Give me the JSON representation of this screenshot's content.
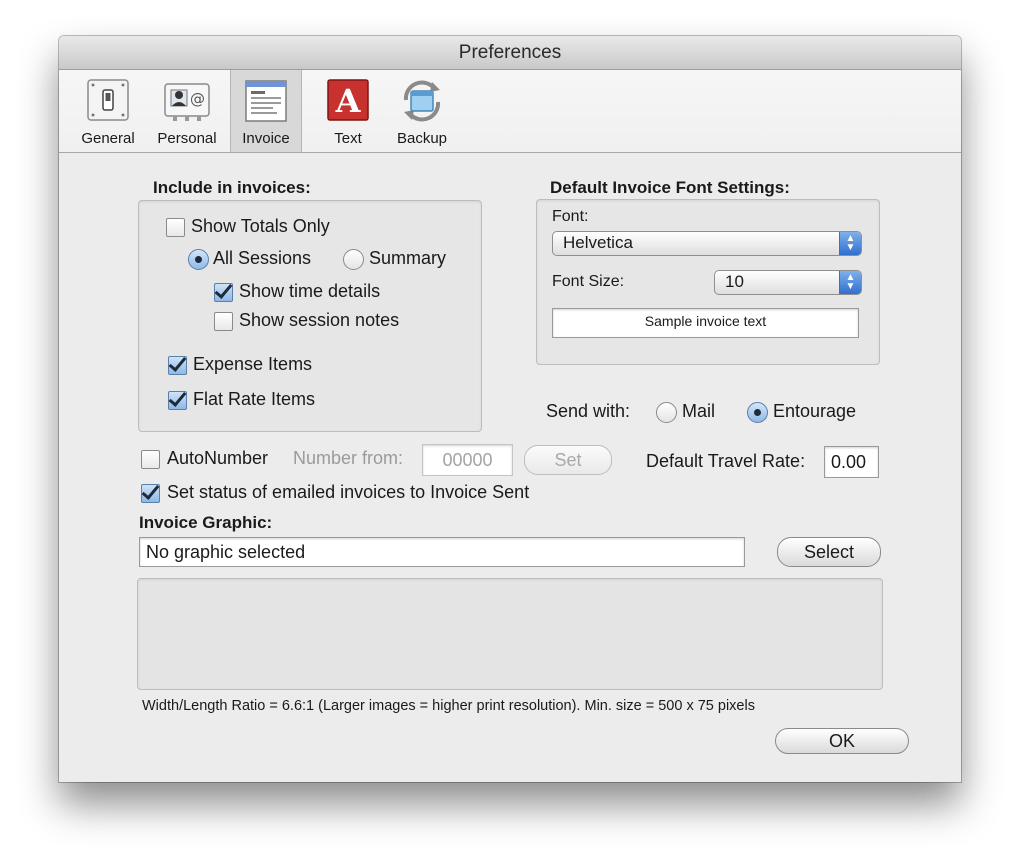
{
  "window": {
    "title": "Preferences"
  },
  "toolbar": {
    "items": [
      {
        "label": "General",
        "icon": "general-switch-icon"
      },
      {
        "label": "Personal",
        "icon": "personal-card-icon"
      },
      {
        "label": "Invoice",
        "icon": "invoice-document-icon",
        "selected": true
      },
      {
        "label": "Text",
        "icon": "text-letter-icon"
      },
      {
        "label": "Backup",
        "icon": "backup-sync-icon"
      }
    ]
  },
  "include": {
    "heading": "Include in invoices:",
    "show_totals_only": {
      "label": "Show Totals Only",
      "checked": false
    },
    "all_sessions": {
      "label": "All Sessions",
      "selected": true
    },
    "summary": {
      "label": "Summary",
      "selected": false
    },
    "show_time_details": {
      "label": "Show time details",
      "checked": true
    },
    "show_session_notes": {
      "label": "Show session notes",
      "checked": false
    },
    "expense_items": {
      "label": "Expense Items",
      "checked": true
    },
    "flat_rate_items": {
      "label": "Flat Rate Items",
      "checked": true
    }
  },
  "font_settings": {
    "heading": "Default Invoice Font Settings:",
    "font_label": "Font:",
    "font_value": "Helvetica",
    "size_label": "Font Size:",
    "size_value": "10",
    "sample_text": "Sample invoice text"
  },
  "send_with": {
    "label": "Send with:",
    "mail": {
      "label": "Mail",
      "selected": false
    },
    "entourage": {
      "label": "Entourage",
      "selected": true
    }
  },
  "autonumber": {
    "label": "AutoNumber",
    "checked": false,
    "number_from_label": "Number from:",
    "number_from_value": "00000",
    "set_button": "Set"
  },
  "travel_rate": {
    "label": "Default Travel Rate:",
    "value": "0.00"
  },
  "set_status": {
    "label": "Set status of emailed invoices to Invoice Sent",
    "checked": true
  },
  "graphic": {
    "heading": "Invoice Graphic:",
    "value": "No graphic selected",
    "select_button": "Select",
    "hint": "Width/Length Ratio = 6.6:1 (Larger images = higher print resolution). Min. size = 500 x 75 pixels"
  },
  "ok_button": "OK",
  "colors": {
    "accent": "#2f6fcf",
    "window_bg": "#ececec"
  }
}
